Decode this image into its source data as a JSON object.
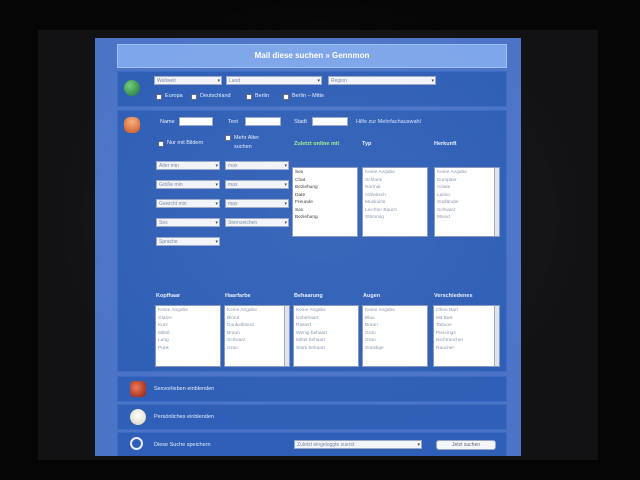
{
  "title": "Mail diese suchen » Gennmon",
  "location": {
    "selects": [
      "Weltweit",
      "Land",
      "Region"
    ],
    "checks": [
      "Europa",
      "Deutschland",
      "Berlin",
      "Berlin – Mitte"
    ]
  },
  "person": {
    "name_label": "Name",
    "text_label": "Text",
    "city_label": "Stadt",
    "help_link": "Hilfe zur Mehrfachauswahl",
    "only_images": "Nur mit Bildern",
    "more_age": "Mehr Alter suchen",
    "col_headers": {
      "wanted": "Zuletzt online mit",
      "type": "Typ",
      "origin": "Herkunft"
    },
    "range_selects": [
      [
        "Alter min",
        "max"
      ],
      [
        "Größe min",
        "max"
      ],
      [
        "Gewicht min",
        "max"
      ],
      [
        "Sex",
        "Sternzeichen"
      ]
    ],
    "language": "Sprache",
    "wanted_list": [
      "Sex",
      "Chat",
      "Beziehung",
      "Date",
      "Freunde",
      "Sex",
      "Beziehung"
    ],
    "type_list": [
      "Keine Angabe",
      "Schlank",
      "Normal",
      "Athletisch",
      "Muskulös",
      "Leichter Bauch",
      "Stämmig"
    ],
    "origin_list": [
      "Keine Angabe",
      "Europäer",
      "Asiate",
      "Latino",
      "Südländer",
      "Schwarz",
      "Mixed"
    ],
    "lower_headers": [
      "Kopfhaar",
      "Haarfarbe",
      "Behaarung",
      "Augen",
      "Verschiedenes"
    ],
    "hair_list": [
      "Keine Angabe",
      "Glatze",
      "Kurz",
      "Mittel",
      "Lang",
      "Punk"
    ],
    "haircolor_list": [
      "Keine Angabe",
      "Blond",
      "Dunkelblond",
      "Braun",
      "Schwarz",
      "Grau"
    ],
    "body_list": [
      "Keine Angabe",
      "Unbehaart",
      "Rasiert",
      "Wenig behaart",
      "Mittel behaart",
      "Stark behaart"
    ],
    "eyes_list": [
      "Keine Angabe",
      "Blau",
      "Braun",
      "Grün",
      "Grau",
      "Sonstige"
    ],
    "misc_list": [
      "Ohne Bart",
      "Mit Bart",
      "Tattoos",
      "Piercings",
      "Nichtraucher",
      "Raucher"
    ]
  },
  "sections": {
    "interests": "Sexvorlieben einblenden",
    "personal": "Persönliches einblenden",
    "save": "Diese Suche speichern",
    "save_select": "Zuletzt eingeloggte zuerst",
    "submit": "Jetzt suchen"
  },
  "colors": {
    "page": "#4c74c6",
    "panel": "#2f5fb6",
    "title": "#7ea6ea"
  }
}
